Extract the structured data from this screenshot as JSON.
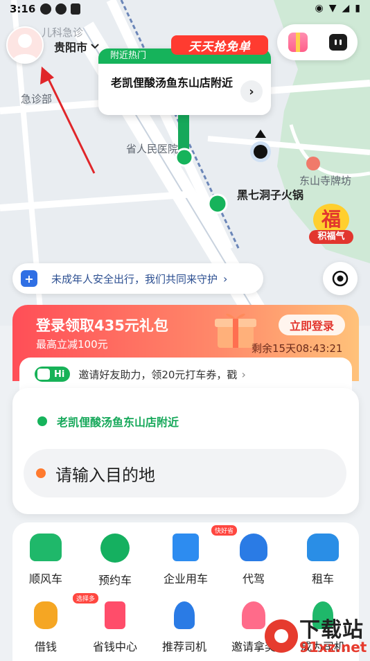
{
  "status_bar": {
    "time": "3:16"
  },
  "header": {
    "city": "贵阳市",
    "city_chevron": "chevron-down-icon"
  },
  "promo_badge": "天天抢免单",
  "hot_place": {
    "header": "附近热门",
    "text": "老凯俚酸汤鱼东山店附近"
  },
  "map": {
    "labels": [
      "急诊部",
      "儿科急诊",
      "省人民医院",
      "东山寺牌坊",
      "黑七洞子火锅"
    ],
    "fortune_badge": {
      "top": "福",
      "bottom": "积福气"
    }
  },
  "safety": {
    "text": "未成年人安全出行，我们共同来守护"
  },
  "login_promo": {
    "title": "登录领取435元礼包",
    "subtitle": "最高立减100元",
    "button": "立即登录",
    "countdown": "剩余15天08:43:21"
  },
  "invite": {
    "badge": "Hi",
    "text": "邀请好友助力，领20元打车券，戳"
  },
  "destination": {
    "current_location": "老凯俚酸汤鱼东山店附近",
    "placeholder": "请输入目的地"
  },
  "services": [
    {
      "label": "顺风车",
      "icon": "carpool-car-icon",
      "color": "#1fb86a",
      "tag": ""
    },
    {
      "label": "预约车",
      "icon": "clock-timer-icon",
      "color": "#15b060",
      "tag": ""
    },
    {
      "label": "企业用车",
      "icon": "building-icon",
      "color": "#2d8cf0",
      "tag": "快好省"
    },
    {
      "label": "代驾",
      "icon": "driver-icon",
      "color": "#2a7be5",
      "tag": ""
    },
    {
      "label": "租车",
      "icon": "rental-car-icon",
      "color": "#2a8ee6",
      "tag": ""
    },
    {
      "label": "借钱",
      "icon": "money-bag-icon",
      "color": "#f5a623",
      "tag": "选择多"
    },
    {
      "label": "省钱中心",
      "icon": "savings-icon",
      "color": "#ff4d6a",
      "tag": ""
    },
    {
      "label": "推荐司机",
      "icon": "person-icon",
      "color": "#2a7be5",
      "tag": ""
    },
    {
      "label": "邀请拿奖",
      "icon": "people-icon",
      "color": "#ff6b8a",
      "tag": ""
    },
    {
      "label": "成为司机",
      "icon": "driver-person-icon",
      "color": "#1fb86a",
      "tag": ""
    }
  ],
  "watermark": {
    "text": "下载站",
    "url": "91xz.net"
  },
  "colors": {
    "accent_green": "#16b35b",
    "promo_red": "#ff4e57",
    "link_blue": "#2c4f91"
  }
}
